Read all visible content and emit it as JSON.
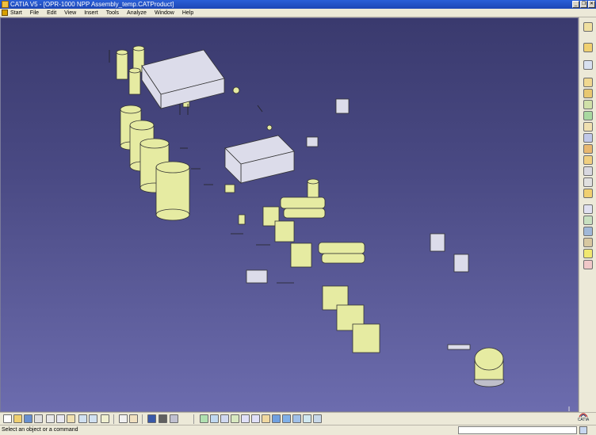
{
  "window": {
    "title": "CATIA V5 - [OPR-1000 NPP Assembly_temp.CATProduct]",
    "minimize": "_",
    "restore": "❐",
    "close": "✕"
  },
  "menu": {
    "items": [
      "Start",
      "File",
      "Edit",
      "View",
      "Insert",
      "Tools",
      "Analyze",
      "Window",
      "Help"
    ]
  },
  "status": {
    "message": "Select an object or a command",
    "command_value": ""
  },
  "logo": {
    "text": "CATIA"
  },
  "colors": {
    "titlebar": "#1d47b5",
    "viewport_bg": "#4a4a84",
    "part_yellow": "#e6eba2",
    "part_grey": "#dcdcea",
    "part_outline": "#333333"
  },
  "right_toolbar_icons": [
    "select-icon",
    "sketch-icon",
    "rotate-icon",
    "product-icon",
    "component-icon",
    "existing-component-icon",
    "replace-icon",
    "graph-tree-icon",
    "generate-numbering-icon",
    "selective-load-icon",
    "manage-representations-icon",
    "multi-instantiation-icon",
    "fast-multi-instantiation-icon",
    "reorder-icon",
    "constraint-icon",
    "snap-icon",
    "explode-icon",
    "stop-manipulate-icon",
    "catalog-icon",
    "update-icon",
    "bulb-icon",
    "clash-icon"
  ],
  "bottom_toolbar_icons": [
    "new-icon",
    "open-icon",
    "save-icon",
    "print-icon",
    "cut-icon",
    "copy-icon",
    "paste-icon",
    "undo-icon",
    "redo-icon",
    "whats-this-icon",
    "formula-icon",
    "knowledge-icon",
    "display-icon",
    "material-icon",
    "render-icon",
    "fly-mode-icon",
    "fit-all-icon",
    "pan-icon",
    "rotate-view-icon",
    "zoom-in-icon",
    "zoom-out-icon",
    "normal-view-icon",
    "create-view-icon",
    "isometric-view-icon",
    "shading-icon",
    "hide-show-icon",
    "swap-visible-icon",
    "measure-icon",
    "apply-material-icon"
  ]
}
